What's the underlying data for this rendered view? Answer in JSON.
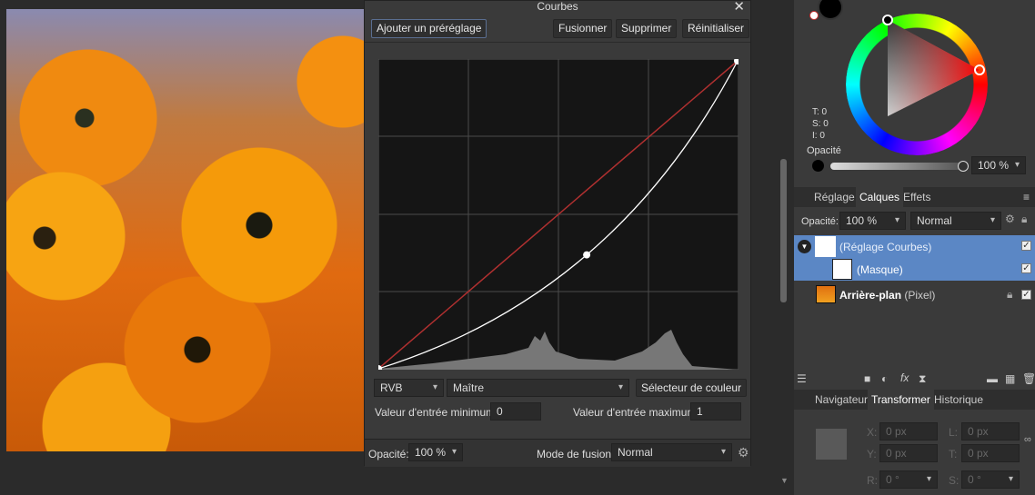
{
  "dialog": {
    "title": "Courbes",
    "add_preset": "Ajouter un préréglage",
    "merge": "Fusionner",
    "delete": "Supprimer",
    "reset": "Réinitialiser",
    "color_space": "RVB",
    "channel": "Maître",
    "color_picker": "Sélecteur de couleur",
    "min_label": "Valeur d'entrée minimum:",
    "min_value": "0",
    "max_label": "Valeur d'entrée maximum:",
    "max_value": "1",
    "opacity_label": "Opacité:",
    "opacity_value": "100 %",
    "blend_label": "Mode de fusion:",
    "blend_value": "Normal",
    "curve_points": [
      [
        0,
        0
      ],
      [
        0.58,
        0.37
      ],
      [
        1,
        1
      ]
    ],
    "colors": {
      "diagonal": "#b03030",
      "curve": "#ffffff"
    }
  },
  "color": {
    "t": "T: 0",
    "s": "S: 0",
    "i": "I: 0",
    "opacity_label": "Opacité",
    "opacity_value": "100 %",
    "hue_color": "#ff0000"
  },
  "layers_tabs": [
    "Réglage",
    "Calques",
    "Effets"
  ],
  "layers": {
    "opacity_label": "Opacité:",
    "opacity_value": "100 %",
    "blend": "Normal",
    "items": [
      {
        "name": "(Réglage Courbes)",
        "sub": ""
      },
      {
        "name": "(Masque)",
        "sub": ""
      },
      {
        "name": "Arrière-plan",
        "sub": " (Pixel)"
      }
    ]
  },
  "bottom_tabs": [
    "Navigateur",
    "Transformer",
    "Historique"
  ],
  "transform": {
    "x_label": "X:",
    "x": "0 px",
    "y_label": "Y:",
    "y": "0 px",
    "w_label": "L:",
    "w": "0 px",
    "h_label": "T:",
    "h": "0 px",
    "r_label": "R:",
    "r": "0 °",
    "s_label": "S:",
    "s": "0 °"
  }
}
